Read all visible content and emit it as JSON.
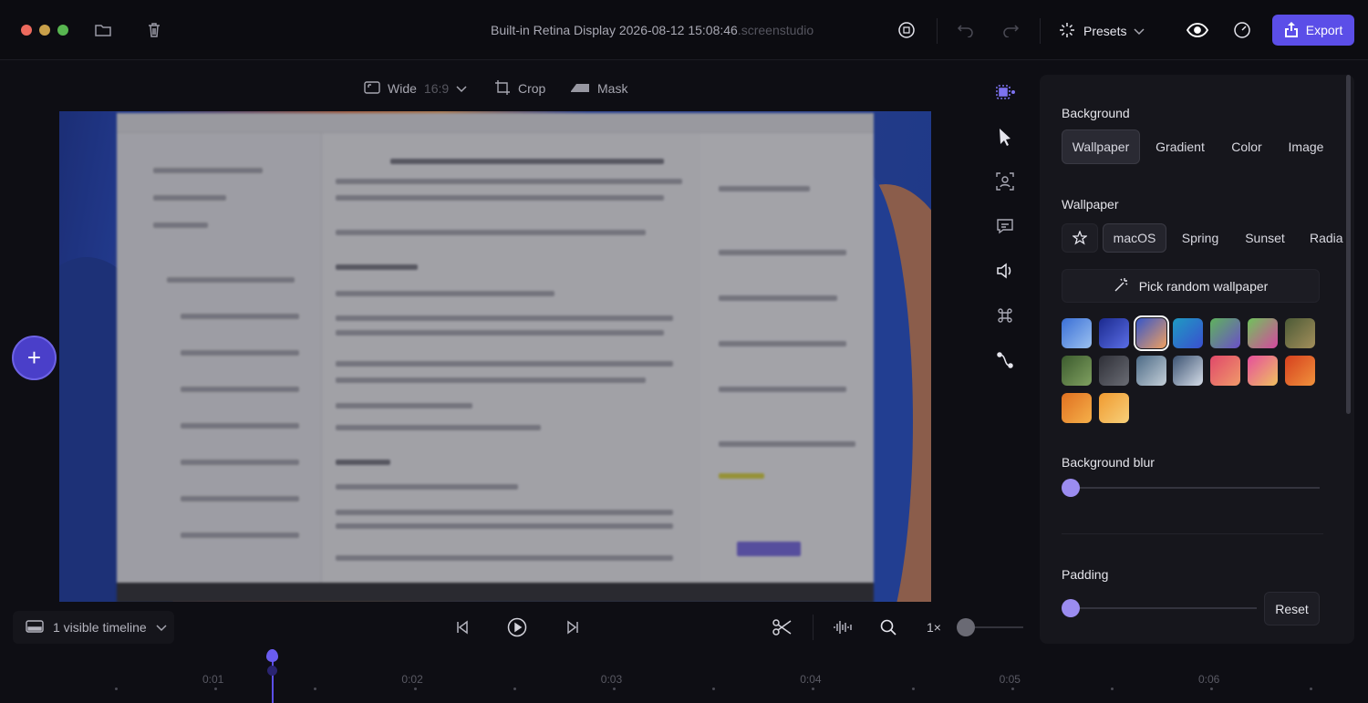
{
  "titlebar": {
    "title": "Built-in Retina Display 2026-08-12 15:08:46",
    "title_ext": ".screenstudio",
    "presets_label": "Presets",
    "export_label": "Export"
  },
  "toolbar": {
    "aspect_label": "Wide",
    "aspect_ratio": "16:9",
    "crop_label": "Crop",
    "mask_label": "Mask"
  },
  "panel": {
    "background_heading": "Background",
    "bg_tabs": [
      "Wallpaper",
      "Gradient",
      "Color",
      "Image"
    ],
    "bg_tab_active": "Wallpaper",
    "wallpaper_heading": "Wallpaper",
    "wallpaper_sets": [
      "macOS",
      "Spring",
      "Sunset",
      "Radia"
    ],
    "wallpaper_set_active": "macOS",
    "random_label": "Pick random wallpaper",
    "thumbnails": [
      {
        "name": "blue-wave",
        "colors": [
          "#3a6fd6",
          "#9bc1f0"
        ]
      },
      {
        "name": "dark-blue-wave",
        "colors": [
          "#1b2a8f",
          "#5b6ee6"
        ]
      },
      {
        "name": "sunset-wave",
        "colors": [
          "#3556c9",
          "#f0a060"
        ],
        "selected": true
      },
      {
        "name": "teal-blue",
        "colors": [
          "#1e9bc2",
          "#3a4fd0"
        ]
      },
      {
        "name": "green-purple",
        "colors": [
          "#5fb35c",
          "#6b4fc9"
        ]
      },
      {
        "name": "rainbow",
        "colors": [
          "#6fc35b",
          "#d6489f"
        ]
      },
      {
        "name": "mountain",
        "colors": [
          "#4c5a36",
          "#a38f5b"
        ]
      },
      {
        "name": "green-hills",
        "colors": [
          "#3c5b2e",
          "#7fa060"
        ]
      },
      {
        "name": "dark-rock",
        "colors": [
          "#2f3038",
          "#6a6c74"
        ]
      },
      {
        "name": "coast",
        "colors": [
          "#4c6a86",
          "#c4cfd8"
        ]
      },
      {
        "name": "snow-peaks",
        "colors": [
          "#3b5272",
          "#d5dde8"
        ]
      },
      {
        "name": "red-pink",
        "colors": [
          "#e0486a",
          "#f09a6a"
        ]
      },
      {
        "name": "pink-yellow",
        "colors": [
          "#e54f9c",
          "#f0c060"
        ]
      },
      {
        "name": "orange-red",
        "colors": [
          "#d6401e",
          "#f0923c"
        ]
      },
      {
        "name": "orange-flow",
        "colors": [
          "#e07020",
          "#f5b04a"
        ]
      },
      {
        "name": "golden-flow",
        "colors": [
          "#f09a30",
          "#f7d07a"
        ]
      }
    ],
    "blur_label": "Background blur",
    "blur_value": 0,
    "padding_label": "Padding",
    "padding_value": 0,
    "reset_label": "Reset"
  },
  "playback": {
    "timeline_select": "1 visible timeline",
    "speed": "1×"
  },
  "timeline": {
    "ticks": [
      "0:01",
      "0:02",
      "0:03",
      "0:04",
      "0:05",
      "0:06"
    ],
    "playhead_time": "0:01.3"
  },
  "colors": {
    "accent": "#5b4ee8",
    "slider": "#9b8cf0"
  }
}
